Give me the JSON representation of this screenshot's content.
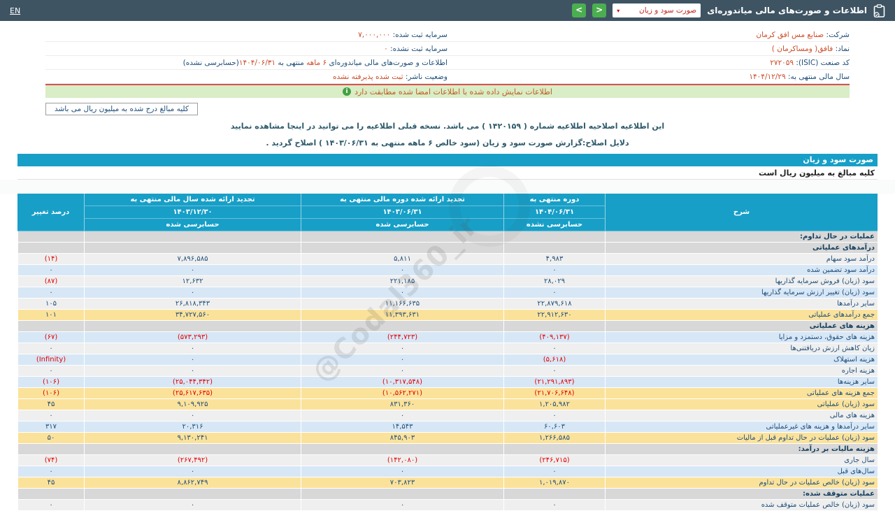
{
  "topbar": {
    "en_label": "EN",
    "title": "اطلاعات و صورت‌های مالی میاندوره‌ای",
    "dropdown_value": "صورت سود و زیان",
    "dropdown_caret": "▾",
    "nav_prev": "<",
    "nav_next": ">"
  },
  "company": {
    "right": [
      {
        "label": "شرکت:",
        "value": "صنایع مس افق کرمان"
      },
      {
        "label": "نماد:",
        "value": "فافق( ومساکرمان )"
      },
      {
        "label": "کد صنعت (ISIC):",
        "value": "۲۷۲۰۵۹"
      },
      {
        "label": "سال مالی منتهی به:",
        "value": "۱۴۰۴/۱۲/۲۹"
      }
    ],
    "left": [
      {
        "label": "سرمایه ثبت شده:",
        "value": "۷,۰۰۰,۰۰۰"
      },
      {
        "label": "سرمایه ثبت نشده:",
        "value": "۰"
      },
      {
        "p1": "اطلاعات و صورت‌های مالی میاندوره‌ای ",
        "hl1": "۶ ماهه",
        "p2": " منتهی به ",
        "hl2": "۱۴۰۴/۰۶/۳۱",
        "p3": "(حسابرسی نشده)"
      },
      {
        "label": "وضعیت ناشر:",
        "value": "ثبت شده پذیرفته نشده"
      }
    ]
  },
  "banner": {
    "icon": "i",
    "text": "اطلاعات نمایش داده شده با اطلاعات امضا شده مطابقت دارد"
  },
  "unit_box": "کلیه مبالغ درج شده به میلیون ریال می باشد",
  "notices": [
    "این اطلاعیه اصلاحیه اطلاعیه شماره ( ۱۴۲۰۱۵۹ ) می باشد. نسخه قبلی اطلاعیه را می توانید در اینجا مشاهده نمایید",
    "دلایل اصلاح:گزارش صورت سود و زیان (سود خالص ۶ ماهه منتهی به ۱۴۰۳/۰۶/۳۱ ) اصلاح گردید ."
  ],
  "statement": {
    "title": "صورت سود و زیان",
    "unit_note": "کلیه مبالغ به میلیون ریال است"
  },
  "table": {
    "headers": {
      "desc": "شرح",
      "col1": {
        "title": "دوره منتهی به",
        "date": "۱۴۰۴/۰۶/۳۱",
        "audit": "حسابرسی نشده"
      },
      "col2": {
        "title": "تجدید ارائه شده دوره مالی منتهی به",
        "date": "۱۴۰۳/۰۶/۳۱",
        "audit": "حسابرسی شده"
      },
      "col3": {
        "title": "تجدید ارائه شده سال مالی منتهی به",
        "date": "۱۴۰۳/۱۲/۳۰",
        "audit": "حسابرسی شده"
      },
      "pct": "درصد تغییر"
    },
    "rows": [
      {
        "label": "عملیات در حال تداوم:",
        "style": "section"
      },
      {
        "label": "درآمدهای عملیاتی",
        "style": "section"
      },
      {
        "label": "درآمد سود سهام",
        "c1": "۴,۹۸۳",
        "c2": "۵,۸۱۱",
        "c3": "۷,۸۹۶,۵۸۵",
        "pct": "(۱۴)",
        "style": "light"
      },
      {
        "label": "درآمد سود تضمین شده",
        "c1": "۰",
        "c2": "۰",
        "c3": "۰",
        "pct": "۰",
        "style": "blue"
      },
      {
        "label": "سود (زیان) فروش سرمایه گذاریها",
        "c1": "۲۸,۰۲۹",
        "c2": "۲۲۱,۱۸۵",
        "c3": "۱۲,۶۳۲",
        "pct": "(۸۷)",
        "style": "light"
      },
      {
        "label": "سود (زیان) تغییر ارزش سرمایه گذاریها",
        "c1": "۰",
        "c2": "۰",
        "c3": "۰",
        "pct": "۰",
        "style": "blue"
      },
      {
        "label": "سایر درآمدها",
        "c1": "۲۲,۸۷۹,۶۱۸",
        "c2": "۱۱,۱۶۶,۶۳۵",
        "c3": "۲۶,۸۱۸,۳۴۳",
        "pct": "۱۰۵",
        "style": "light"
      },
      {
        "label": "جمع درآمدهای عملیاتی",
        "c1": "۲۲,۹۱۲,۶۳۰",
        "c2": "۱۱,۳۹۳,۶۳۱",
        "c3": "۳۴,۷۲۷,۵۶۰",
        "pct": "۱۰۱",
        "style": "yellow"
      },
      {
        "label": "هزینه های عملیاتی",
        "style": "section"
      },
      {
        "label": "هزینه های حقوق، دستمزد و مزایا",
        "c1": "(۴۰۹,۱۳۷)",
        "c2": "(۲۴۴,۷۲۳)",
        "c3": "(۵۷۳,۲۹۳)",
        "pct": "(۶۷)",
        "style": "blue"
      },
      {
        "label": "زیان کاهش ارزش دریافتنی‌ها",
        "c1": "۰",
        "c2": "۰",
        "c3": "۰",
        "pct": "۰",
        "style": "light"
      },
      {
        "label": "هزینه استهلاک",
        "c1": "(۵,۶۱۸)",
        "c2": "۰",
        "c3": "۰",
        "pct": "(Infinity)",
        "style": "blue"
      },
      {
        "label": "هزینه اجاره",
        "c1": "۰",
        "c2": "۰",
        "c3": "۰",
        "pct": "۰",
        "style": "light"
      },
      {
        "label": "سایر هزینه‌ها",
        "c1": "(۲۱,۲۹۱,۸۹۳)",
        "c2": "(۱۰,۳۱۷,۵۴۸)",
        "c3": "(۲۵,۰۴۴,۳۴۲)",
        "pct": "(۱۰۶)",
        "style": "blue"
      },
      {
        "label": "جمع هزینه های عملیاتی",
        "c1": "(۲۱,۷۰۶,۶۴۸)",
        "c2": "(۱۰,۵۶۲,۲۷۱)",
        "c3": "(۲۵,۶۱۷,۶۳۵)",
        "pct": "(۱۰۶)",
        "style": "yellow"
      },
      {
        "label": "سود (زیان) عملیاتی",
        "c1": "۱,۲۰۵,۹۸۲",
        "c2": "۸۳۱,۳۶۰",
        "c3": "۹,۱۰۹,۹۲۵",
        "pct": "۴۵",
        "style": "yellow"
      },
      {
        "label": "هزینه های مالی",
        "c1": "۰",
        "c2": "۰",
        "c3": "۰",
        "pct": "۰",
        "style": "light"
      },
      {
        "label": "سایر درآمدها و هزینه های غیرعملیاتی",
        "c1": "۶۰,۶۰۳",
        "c2": "۱۴,۵۴۳",
        "c3": "۲۰,۳۱۶",
        "pct": "۳۱۷",
        "style": "blue"
      },
      {
        "label": "سود (زیان) عملیات در حال تداوم قبل از مالیات",
        "c1": "۱,۲۶۶,۵۸۵",
        "c2": "۸۴۵,۹۰۳",
        "c3": "۹,۱۳۰,۲۴۱",
        "pct": "۵۰",
        "style": "yellow"
      },
      {
        "label": "هزینه مالیات بر درآمد:",
        "style": "section"
      },
      {
        "label": "سال جاری",
        "c1": "(۲۴۶,۷۱۵)",
        "c2": "(۱۴۲,۰۸۰)",
        "c3": "(۲۶۷,۴۹۲)",
        "pct": "(۷۴)",
        "style": "light"
      },
      {
        "label": "سال‌های قبل",
        "c1": "۰",
        "c2": "۰",
        "c3": "۰",
        "pct": "۰",
        "style": "blue"
      },
      {
        "label": "سود (زیان) خالص عملیات در حال تداوم",
        "c1": "۱,۰۱۹,۸۷۰",
        "c2": "۷۰۳,۸۲۳",
        "c3": "۸,۸۶۲,۷۴۹",
        "pct": "۴۵",
        "style": "yellow"
      },
      {
        "label": "عملیات متوقف شده:",
        "style": "section"
      },
      {
        "label": "سود (زیان) خالص عملیات متوقف شده",
        "c1": "۰",
        "c2": "۰",
        "c3": "۰",
        "pct": "۰",
        "style": "light"
      }
    ]
  },
  "watermark": "@Codal360_ir"
}
